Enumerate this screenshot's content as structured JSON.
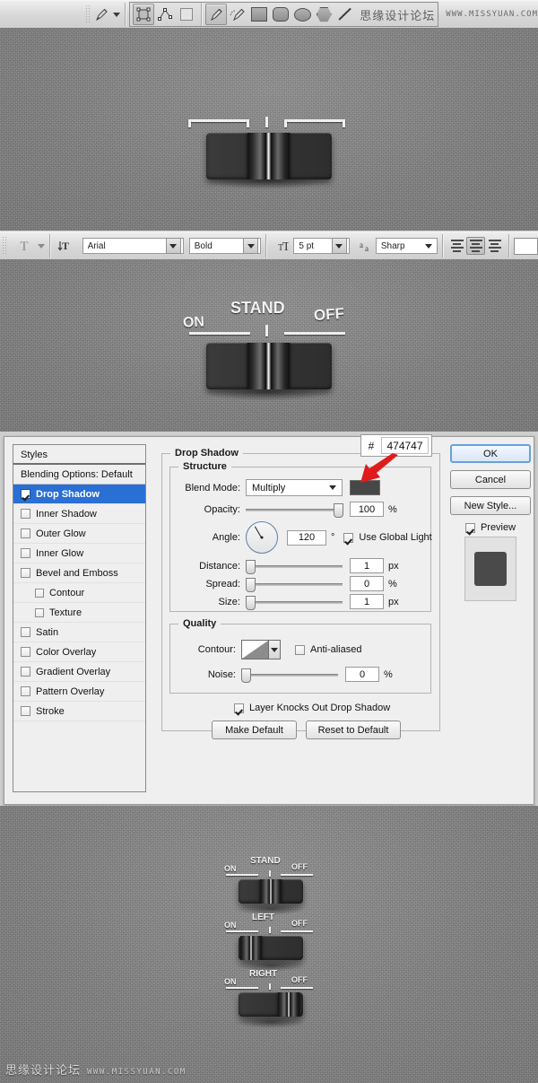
{
  "toolbar_shapes": {
    "pen_tool_icon": "pen-tool",
    "path_mode_label": "path-selection",
    "items": [
      "path-selection-icon",
      "direct-selection-icon",
      "empty-square-icon",
      "pen-tool-icon",
      "freeform-pen-icon",
      "rectangle-icon",
      "rounded-rectangle-icon",
      "ellipse-icon",
      "polygon-icon",
      "line-icon",
      "custom-shape-icon"
    ],
    "watermark_cn": "思缘设计论坛",
    "watermark_url": "WWW.MISSYUAN.COM"
  },
  "toolbar_text": {
    "tool_icon": "type-tool",
    "orientation_icon": "text-orientation",
    "font_family": "Arial",
    "font_style": "Bold",
    "font_size": "5 pt",
    "anti_alias_label": "aa",
    "anti_alias": "Sharp",
    "align": [
      "align-left",
      "align-center",
      "align-right"
    ],
    "align_selected": "align-center",
    "color_swatch": "#ffffff"
  },
  "switch_top": {
    "labels": {
      "left": "",
      "center": "",
      "right": ""
    }
  },
  "switch_mid": {
    "labels": {
      "left": "ON",
      "center": "STAND",
      "right": "OFF"
    }
  },
  "switch_list": [
    {
      "labels": {
        "left": "ON",
        "center": "STAND",
        "right": "OFF"
      },
      "knob": "center"
    },
    {
      "labels": {
        "left": "ON",
        "center": "LEFT",
        "right": "OFF"
      },
      "knob": "left"
    },
    {
      "labels": {
        "left": "ON",
        "center": "RIGHT",
        "right": "OFF"
      },
      "knob": "right"
    }
  ],
  "dialog": {
    "styles_header": "Styles",
    "blending_options": "Blending Options: Default",
    "style_items": [
      {
        "label": "Drop Shadow",
        "checked": true,
        "selected": true,
        "indent": false
      },
      {
        "label": "Inner Shadow",
        "checked": false,
        "selected": false,
        "indent": false
      },
      {
        "label": "Outer Glow",
        "checked": false,
        "selected": false,
        "indent": false
      },
      {
        "label": "Inner Glow",
        "checked": false,
        "selected": false,
        "indent": false
      },
      {
        "label": "Bevel and Emboss",
        "checked": false,
        "selected": false,
        "indent": false
      },
      {
        "label": "Contour",
        "checked": false,
        "selected": false,
        "indent": true
      },
      {
        "label": "Texture",
        "checked": false,
        "selected": false,
        "indent": true
      },
      {
        "label": "Satin",
        "checked": false,
        "selected": false,
        "indent": false
      },
      {
        "label": "Color Overlay",
        "checked": false,
        "selected": false,
        "indent": false
      },
      {
        "label": "Gradient Overlay",
        "checked": false,
        "selected": false,
        "indent": false
      },
      {
        "label": "Pattern Overlay",
        "checked": false,
        "selected": false,
        "indent": false
      },
      {
        "label": "Stroke",
        "checked": false,
        "selected": false,
        "indent": false
      }
    ],
    "panel_title": "Drop Shadow",
    "structure": {
      "title": "Structure",
      "blend_mode_label": "Blend Mode:",
      "blend_mode_value": "Multiply",
      "shadow_color": "#474747",
      "opacity_label": "Opacity:",
      "opacity_value": "100",
      "opacity_unit": "%",
      "angle_label": "Angle:",
      "angle_value": "120",
      "angle_unit": "°",
      "use_global_light": "Use Global Light",
      "use_global_light_checked": true,
      "distance_label": "Distance:",
      "distance_value": "1",
      "distance_unit": "px",
      "spread_label": "Spread:",
      "spread_value": "0",
      "spread_unit": "%",
      "size_label": "Size:",
      "size_value": "1",
      "size_unit": "px"
    },
    "quality": {
      "title": "Quality",
      "contour_label": "Contour:",
      "anti_aliased": "Anti-aliased",
      "anti_aliased_checked": false,
      "noise_label": "Noise:",
      "noise_value": "0",
      "noise_unit": "%"
    },
    "knockout_label": "Layer Knocks Out Drop Shadow",
    "knockout_checked": true,
    "make_default": "Make Default",
    "reset_default": "Reset to Default",
    "ok": "OK",
    "cancel": "Cancel",
    "new_style": "New Style...",
    "preview_label": "Preview",
    "preview_checked": true,
    "preview_color": "#4a4a4a"
  },
  "hex_callout": {
    "hash": "#",
    "value": "474747"
  },
  "footer": {
    "watermark_cn": "思缘设计论坛",
    "watermark_url": "WWW.MISSYUAN.COM"
  }
}
